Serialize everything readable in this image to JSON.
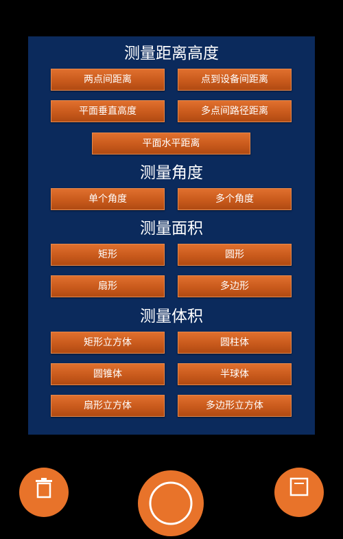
{
  "sections": {
    "distance": {
      "title": "测量距离高度",
      "buttons": [
        "两点间距离",
        "点到设备间距离",
        "平面垂直高度",
        "多点间路径距离",
        "平面水平距离"
      ]
    },
    "angle": {
      "title": "测量角度",
      "buttons": [
        "单个角度",
        "多个角度"
      ]
    },
    "area": {
      "title": "测量面积",
      "buttons": [
        "矩形",
        "圆形",
        "扇形",
        "多边形"
      ]
    },
    "volume": {
      "title": "测量体积",
      "buttons": [
        "矩形立方体",
        "圆柱体",
        "圆锥体",
        "半球体",
        "扇形立方体",
        "多边形立方体"
      ]
    }
  },
  "bottom_bar": {
    "icons": [
      "trash-icon",
      "circle-icon",
      "square-icon"
    ],
    "accent": "#e8732a"
  },
  "colors": {
    "panel": "#0b2a5c",
    "button": "#c95a1c",
    "background": "#000000"
  }
}
